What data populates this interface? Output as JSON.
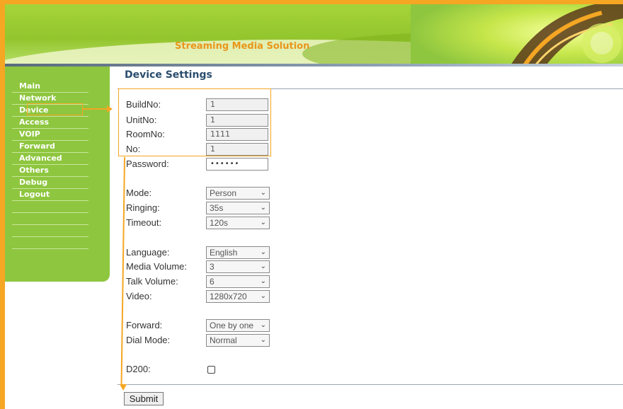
{
  "header": {
    "title": "Streaming Media Solution"
  },
  "sidebar": {
    "items": [
      {
        "label": "Main"
      },
      {
        "label": "Network"
      },
      {
        "label": "Device"
      },
      {
        "label": "Access"
      },
      {
        "label": "VOIP"
      },
      {
        "label": "Forward"
      },
      {
        "label": "Advanced"
      },
      {
        "label": "Others"
      },
      {
        "label": "Debug"
      },
      {
        "label": "Logout"
      }
    ],
    "active": "Device"
  },
  "main": {
    "title": "Device Settings",
    "build_no": {
      "label": "BuildNo:",
      "value": "1"
    },
    "unit_no": {
      "label": "UnitNo:",
      "value": "1"
    },
    "room_no": {
      "label": "RoomNo:",
      "value": "1111"
    },
    "no": {
      "label": "No:",
      "value": "1"
    },
    "password": {
      "label": "Password:",
      "value": "••••••"
    },
    "mode": {
      "label": "Mode:",
      "value": "Person"
    },
    "ringing": {
      "label": "Ringing:",
      "value": "35s"
    },
    "timeout": {
      "label": "Timeout:",
      "value": "120s"
    },
    "language": {
      "label": "Language:",
      "value": "English"
    },
    "media_volume": {
      "label": "Media Volume:",
      "value": "3"
    },
    "talk_volume": {
      "label": "Talk Volume:",
      "value": "6"
    },
    "video": {
      "label": "Video:",
      "value": "1280x720"
    },
    "forward": {
      "label": "Forward:",
      "value": "One by one"
    },
    "dial_mode": {
      "label": "Dial Mode:",
      "value": "Normal"
    },
    "d200": {
      "label": "D200:",
      "checked": false
    },
    "submit_label": "Submit"
  },
  "colors": {
    "accent": "#f5a623",
    "sidebar": "#8ec63f",
    "title": "#2a4d6e"
  }
}
